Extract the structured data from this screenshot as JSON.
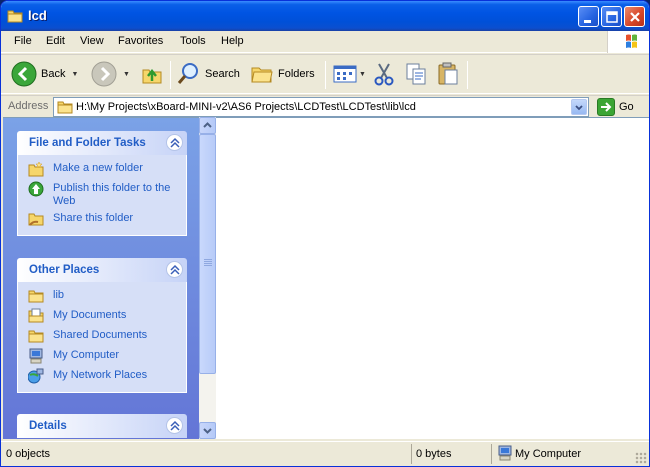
{
  "window": {
    "title": "lcd"
  },
  "menu": [
    {
      "first": "F",
      "rest": "ile"
    },
    {
      "first": "E",
      "rest": "dit"
    },
    {
      "first": "V",
      "rest": "iew"
    },
    {
      "first": "",
      "rest": "Favorites",
      "under": "a"
    },
    {
      "first": "T",
      "rest": "ools"
    },
    {
      "first": "H",
      "rest": "elp"
    }
  ],
  "menu_labels": {
    "file": "File",
    "edit": "Edit",
    "view": "View",
    "favorites": "Favorites",
    "tools": "Tools",
    "help": "Help"
  },
  "toolbar": {
    "back": "Back",
    "search": "Search",
    "folders": "Folders"
  },
  "address": {
    "label": "Address",
    "value": "H:\\My Projects\\xBoard-MINI-v2\\AS6 Projects\\LCDTest\\LCDTest\\lib\\lcd",
    "go": "Go"
  },
  "tasks_panel": {
    "title": "File and Folder Tasks",
    "items": [
      "Make a new folder",
      "Publish this folder to the Web",
      "Share this folder"
    ]
  },
  "places_panel": {
    "title": "Other Places",
    "items": [
      "lib",
      "My Documents",
      "Shared Documents",
      "My Computer",
      "My Network Places"
    ]
  },
  "details_panel": {
    "title": "Details"
  },
  "status": {
    "objects": "0 objects",
    "size": "0 bytes",
    "location": "My Computer"
  },
  "icons": {
    "title": "folder-icon",
    "back": "back-arrow-icon",
    "forward": "forward-arrow-icon",
    "up": "folder-up-icon",
    "search": "magnifier-icon",
    "folders": "folders-icon",
    "views": "views-icon",
    "cut": "scissors-icon",
    "copy": "copy-icon",
    "paste": "paste-icon",
    "go": "go-arrow-icon"
  },
  "colors": {
    "title_bar": "#0054e3",
    "task_link": "#215dc6",
    "close": "#d9482a"
  }
}
